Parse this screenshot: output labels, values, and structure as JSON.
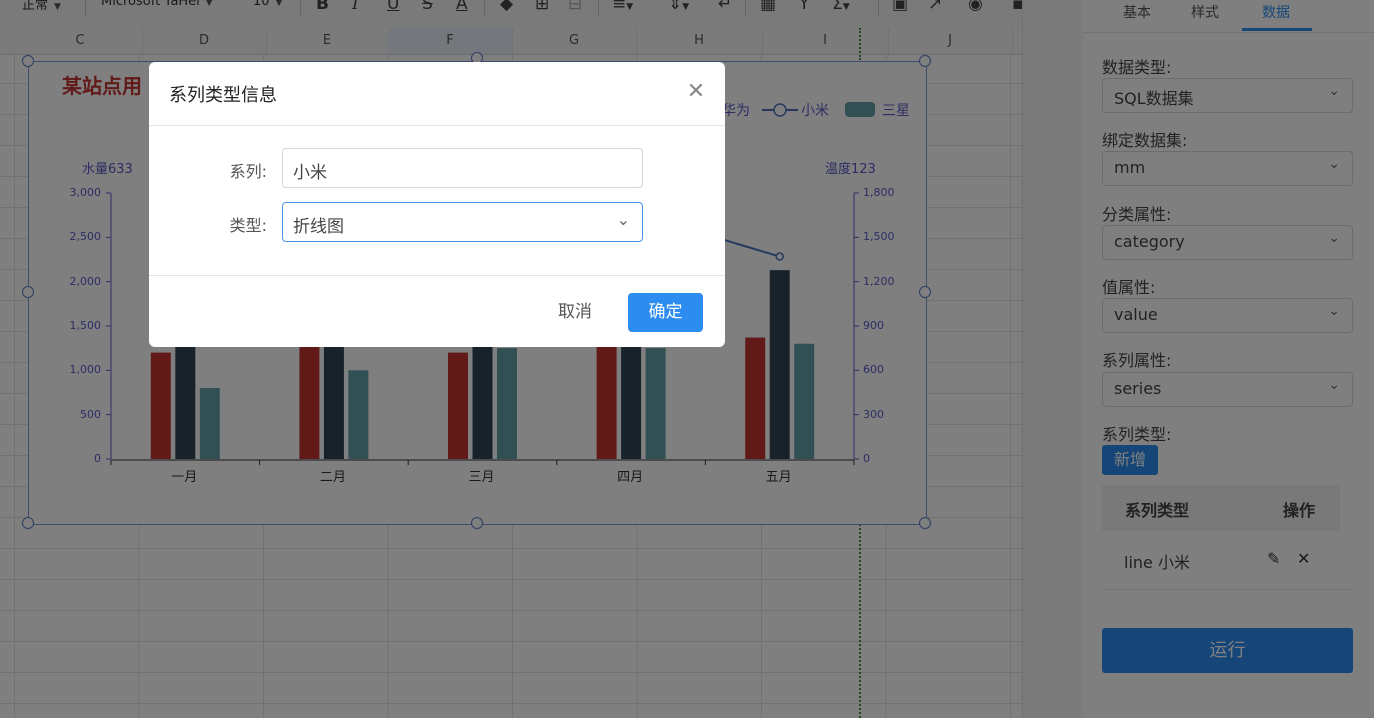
{
  "toolbar": {
    "style_value": "正常",
    "font_family": "Microsoft YaHei",
    "font_size": "10",
    "bold": "B",
    "italic": "I",
    "underline": "U",
    "strike": "S",
    "font_color": "A"
  },
  "sheet": {
    "columns": [
      "C",
      "D",
      "E",
      "F",
      "G",
      "H",
      "I",
      "J"
    ]
  },
  "chart": {
    "title": "某站点用",
    "legend": [
      {
        "label": "华为"
      },
      {
        "label": "小米"
      },
      {
        "label": "三星"
      }
    ],
    "left_axis_name": "水量633",
    "right_axis_name": "温度123",
    "colors": {
      "series1": "#c23531",
      "series2": "#2f4554",
      "series3": "#61a0a8"
    }
  },
  "chart_data": {
    "type": "bar",
    "categories": [
      "一月",
      "二月",
      "三月",
      "四月",
      "五月"
    ],
    "series": [
      {
        "values": [
          1200,
          1300,
          1200,
          1300,
          1370
        ]
      },
      {
        "values": [
          1300,
          1300,
          1300,
          1300,
          2130
        ]
      },
      {
        "values": [
          800,
          1000,
          1250,
          1250,
          1300
        ]
      }
    ],
    "line_series": {
      "name": "小米",
      "visible_points": [
        {
          "x": "五月",
          "y": 1370
        }
      ]
    },
    "ylim_left": [
      0,
      3000
    ],
    "yticks_left": [
      "0",
      "500",
      "1,000",
      "1,500",
      "2,000",
      "2,500",
      "3,000"
    ],
    "ylim_right": [
      0,
      1800
    ],
    "yticks_right": [
      "0",
      "300",
      "600",
      "900",
      "1,200",
      "1,500",
      "1,800"
    ],
    "grid": false,
    "legend_position": "top-right"
  },
  "modal": {
    "title": "系列类型信息",
    "series_label": "系列:",
    "series_value": "小米",
    "type_label": "类型:",
    "type_value": "折线图",
    "cancel_label": "取消",
    "ok_label": "确定"
  },
  "panel": {
    "tabs": [
      "基本",
      "样式",
      "数据"
    ],
    "fields": [
      {
        "label": "数据类型:",
        "value": "SQL数据集"
      },
      {
        "label": "绑定数据集:",
        "value": "mm"
      },
      {
        "label": "分类属性:",
        "value": "category"
      },
      {
        "label": "值属性:",
        "value": "value"
      },
      {
        "label": "系列属性:",
        "value": "series"
      }
    ],
    "series_type_label": "系列类型:",
    "add_label": "新增",
    "table": {
      "headers": [
        "系列类型",
        "操作"
      ],
      "rows": [
        {
          "type": "line 小米"
        }
      ]
    },
    "run_label": "运行"
  }
}
